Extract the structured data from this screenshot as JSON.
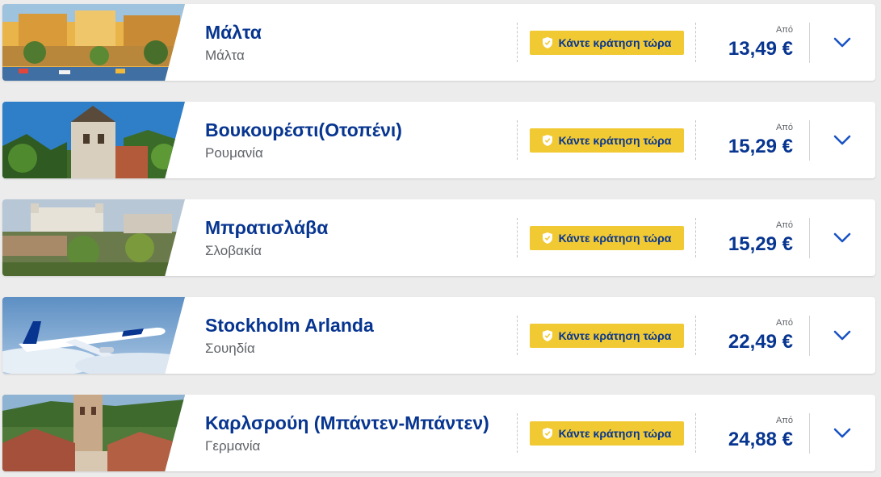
{
  "book_label": "Κάντε κράτηση τώρα",
  "from_label": "Από",
  "icons": {
    "book": "shield-check-icon",
    "expand": "chevron-down-icon"
  },
  "colors": {
    "brand_blue": "#073590",
    "button_yellow": "#f1c933",
    "accent_blue": "#1a53c5"
  },
  "destinations": [
    {
      "name": "Μάλτα",
      "country": "Μάλτα",
      "price": "13,49 €",
      "thumbnail": "malta-harbour-photo"
    },
    {
      "name": "Βουκουρέστι(Οτοπένι)",
      "country": "Ρουμανία",
      "price": "15,29 €",
      "thumbnail": "peles-castle-photo"
    },
    {
      "name": "Μπρατισλάβα",
      "country": "Σλοβακία",
      "price": "15,29 €",
      "thumbnail": "bratislava-castle-photo"
    },
    {
      "name": "Stockholm Arlanda",
      "country": "Σουηδία",
      "price": "22,49 €",
      "thumbnail": "ryanair-plane-photo"
    },
    {
      "name": "Καρλσρούη (Μπάντεν-Μπάντεν)",
      "country": "Γερμανία",
      "price": "24,88 €",
      "thumbnail": "baden-baden-town-photo"
    }
  ]
}
